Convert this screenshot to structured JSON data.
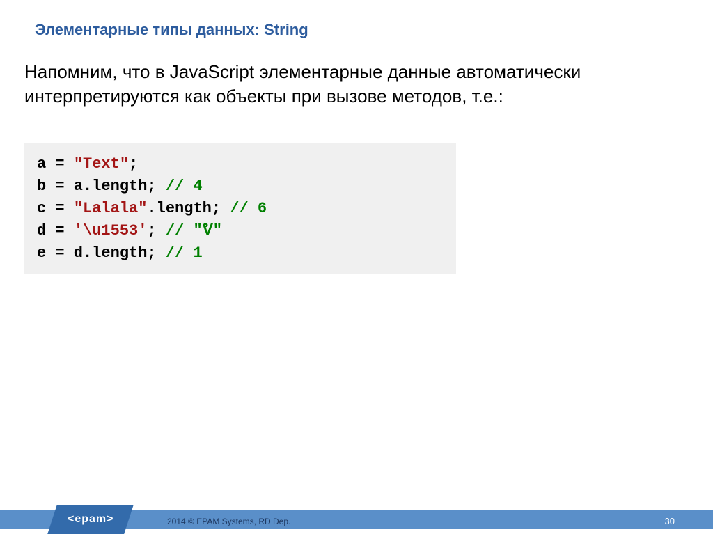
{
  "title": "Элементарные типы данных: String",
  "body": "Напомним, что в JavaScript элементарные данные автоматически интерпретируются как объекты при вызове методов, т.е.:",
  "code": {
    "l1a": "a = ",
    "l1s": "\"Text\"",
    "l1b": ";",
    "l2a": "b = a.length; ",
    "l2c": "// 4",
    "l3a": "c = ",
    "l3s": "\"Lalala\"",
    "l3b": ".length; ",
    "l3c": "// 6",
    "l4a": "d = ",
    "l4s": "'\\u1553'",
    "l4b": "; ",
    "l4c": "// \"ᕓ\"",
    "l5a": "e = d.length; ",
    "l5c": "// 1"
  },
  "footer": {
    "logo": "<epam>",
    "copyright": "2014 © EPAM Systems, RD Dep.",
    "page": "30"
  }
}
